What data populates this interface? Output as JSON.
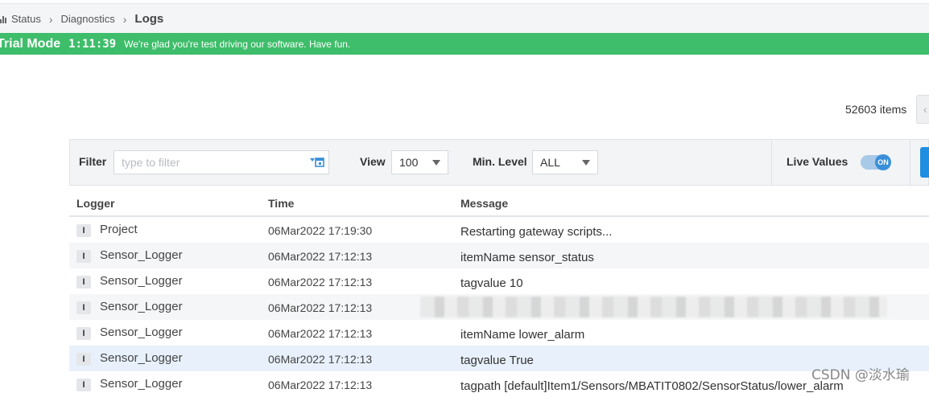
{
  "breadcrumb": {
    "items": [
      "Status",
      "Diagnostics",
      "Logs"
    ]
  },
  "trial": {
    "mode": "Trial Mode",
    "time": "1:11:39",
    "message": "We're glad you're test driving our software. Have fun."
  },
  "items_count": "52603 items",
  "filter": {
    "label": "Filter",
    "placeholder": "type to filter",
    "view_label": "View",
    "view_value": "100",
    "min_level_label": "Min. Level",
    "min_level_value": "ALL",
    "live_values_label": "Live Values",
    "toggle_text": "ON"
  },
  "table": {
    "columns": [
      "Logger",
      "Time",
      "Message"
    ],
    "rows": [
      {
        "level": "I",
        "logger": "Project",
        "time": "06Mar2022 17:19:30",
        "message": "Restarting gateway scripts..."
      },
      {
        "level": "I",
        "logger": "Sensor_Logger",
        "time": "06Mar2022 17:12:13",
        "message": "itemName sensor_status"
      },
      {
        "level": "I",
        "logger": "Sensor_Logger",
        "time": "06Mar2022 17:12:13",
        "message": "tagvalue 10"
      },
      {
        "level": "I",
        "logger": "Sensor_Logger",
        "time": "06Mar2022 17:12:13",
        "message": ""
      },
      {
        "level": "I",
        "logger": "Sensor_Logger",
        "time": "06Mar2022 17:12:13",
        "message": "itemName lower_alarm"
      },
      {
        "level": "I",
        "logger": "Sensor_Logger",
        "time": "06Mar2022 17:12:13",
        "message": "tagvalue True"
      },
      {
        "level": "I",
        "logger": "Sensor_Logger",
        "time": "06Mar2022 17:12:13",
        "message": "tagpath [default]Item1/Sensors/MBATIT0802/SensorStatus/lower_alarm"
      }
    ]
  },
  "watermark": "CSDN @淡水瑜",
  "colors": {
    "trial_green": "#3ebd6a",
    "accent_blue": "#1f8ee0",
    "highlight_row": "#e8f1fb"
  },
  "icons": {
    "breadcrumb_status": "bar-chart-icon",
    "filter_input": "calendar-filter-icon",
    "select_caret": "caret-down-icon"
  }
}
